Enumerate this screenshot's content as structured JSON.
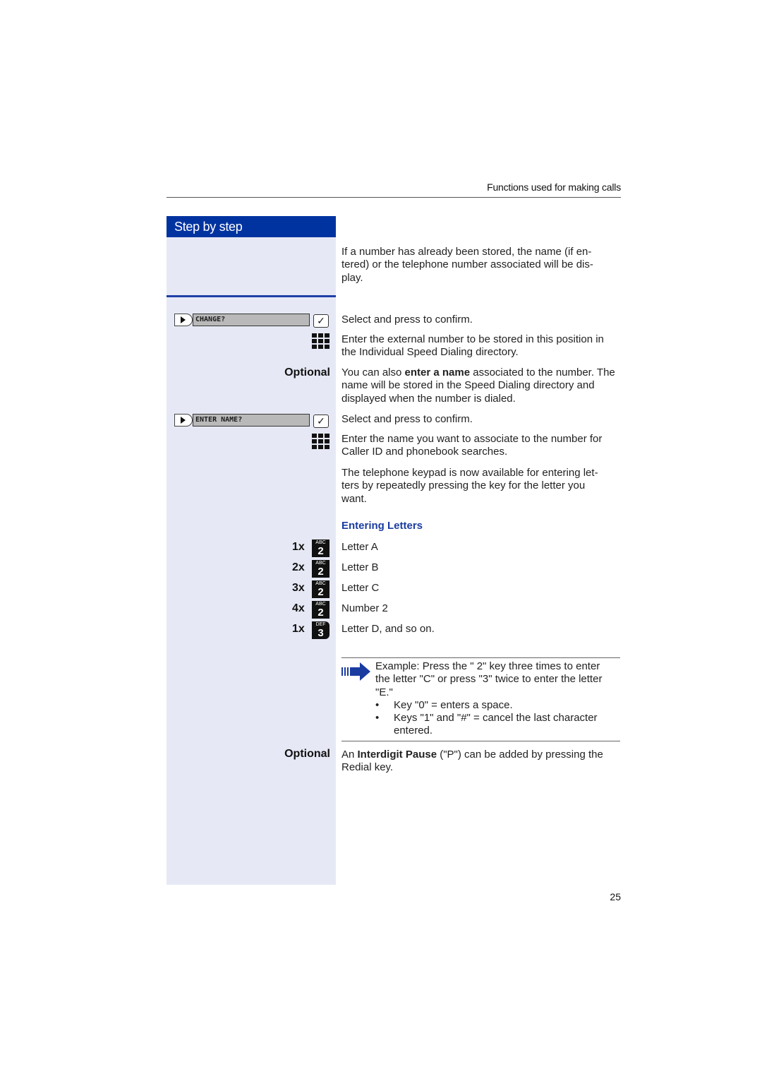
{
  "header": {
    "section_title": "Functions used for making calls"
  },
  "sidebar": {
    "title": "Step by step",
    "optional_label_1": "Optional",
    "optional_label_2": "Optional",
    "menus": [
      {
        "text": "CHANGE?"
      },
      {
        "text": "ENTER NAME?"
      }
    ],
    "check_glyph": "✓"
  },
  "content": {
    "intro": "If a number has already been stored, the name (if en-tered) or the telephone number associated will be dis-play.",
    "intro_lines": [
      "If a number has already been stored, the name (if en-",
      "tered) or the telephone number associated will be dis-",
      "play."
    ],
    "step_select_1": "Select and press to confirm.",
    "step_enter_number": "Enter the external number to be stored in this position in the Individual Speed Dialing directory.",
    "optional_name": {
      "prefix": "You can also ",
      "bold": "enter a name",
      "suffix": " associated to the number. The name will be stored in the Speed Dialing directory and displayed when the number is dialed."
    },
    "step_select_2": "Select and press to confirm.",
    "step_enter_name": "Enter the name you want to associate to the number for Caller ID and phonebook searches.",
    "keypad_info_lines": [
      "The telephone keypad is now available for entering let-",
      "ters by repeatedly pressing the key for the letter you",
      "want."
    ],
    "entering_letters_heading": "Entering Letters",
    "key_presses": [
      {
        "count": "1x",
        "letters": "ABC",
        "digit": "2",
        "result": "Letter A"
      },
      {
        "count": "2x",
        "letters": "ABC",
        "digit": "2",
        "result": "Letter B"
      },
      {
        "count": "3x",
        "letters": "ABC",
        "digit": "2",
        "result": "Letter C"
      },
      {
        "count": "4x",
        "letters": "ABC",
        "digit": "2",
        "result": "Number 2"
      },
      {
        "count": "1x",
        "letters": "DEF",
        "digit": "3",
        "result": "Letter D, and so on."
      }
    ],
    "note": {
      "lines": [
        "Example: Press the \" 2\" key three times to enter",
        "the letter \"C\" or press \"3\" twice to enter the letter",
        "\"E.\""
      ],
      "bullets": [
        {
          "lines": [
            "Key \"0\" = enters a space."
          ]
        },
        {
          "lines": [
            "Keys \"1\" and \"#\" = cancel the last character",
            "entered."
          ]
        }
      ],
      "bullet_glyph": "•"
    },
    "pause": {
      "prefix": "An ",
      "bold": "Interdigit Pause",
      "suffix_line1": " (\"P\") can be added by pressing the",
      "line2": "Redial key."
    }
  },
  "footer": {
    "page_number": "25"
  },
  "colors": {
    "brand_blue": "#0033a0",
    "sidebar_bg": "#e6e9f5",
    "heading_blue": "#1a3ca0"
  }
}
